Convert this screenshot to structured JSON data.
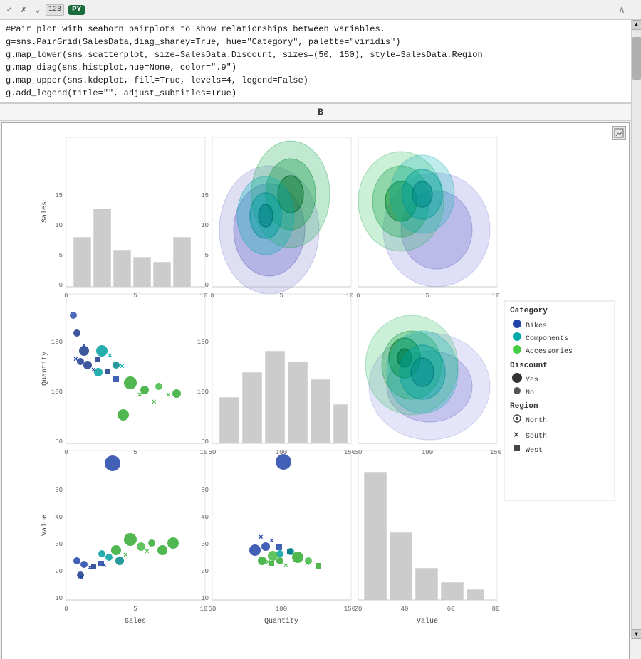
{
  "toolbar": {
    "check_icon": "✓",
    "x_icon": "✗",
    "chevron_icon": "⌄",
    "badge_label": "123",
    "py_label": "PY"
  },
  "code": {
    "lines": [
      "#Pair plot with seaborn pairplots to show relationships between variables.",
      "g=sns.PairGrid(SalesData,diag_sharey=True, hue=\"Category\", palette=\"viridis\")",
      "g.map_lower(sns.scatterplot, size=SalesData.Discount, sizes=(50, 150), style=SalesData.Region",
      "g.map_diag(sns.histplot,hue=None, color=\".9\")",
      "g.map_upper(sns.kdeplot, fill=True, levels=4, legend=False)",
      "g.add_legend(title=\"\", adjust_subtitles=True)"
    ]
  },
  "formula_bar": {
    "label": "B"
  },
  "legend": {
    "title_category": "Category",
    "items_category": [
      {
        "label": "Bikes",
        "color": "#2244aa"
      },
      {
        "label": "Components",
        "color": "#00b0b0"
      },
      {
        "label": "Accessories",
        "color": "#44cc44"
      }
    ],
    "title_discount": "Discount",
    "items_discount": [
      {
        "label": "Yes",
        "size": 10
      },
      {
        "label": "No",
        "size": 7
      }
    ],
    "title_region": "Region",
    "items_region": [
      {
        "label": "North",
        "marker": "circle"
      },
      {
        "label": "South",
        "marker": "x"
      },
      {
        "label": "West",
        "marker": "square"
      }
    ]
  },
  "axes": {
    "row_labels": [
      "Sales",
      "Quantity",
      "Value"
    ],
    "col_labels": [
      "Sales",
      "Quantity",
      "Value"
    ],
    "x_sales_ticks": [
      "0",
      "5",
      "10"
    ],
    "x_quantity_ticks": [
      "50",
      "100",
      "150"
    ],
    "x_value_ticks": [
      "20",
      "40",
      "60",
      "80"
    ],
    "y_sales_ticks": [
      "0",
      "5",
      "10",
      "15"
    ],
    "y_quantity_ticks": [
      "50",
      "100",
      "150"
    ],
    "y_value_ticks": [
      "20",
      "30",
      "40",
      "50"
    ]
  }
}
